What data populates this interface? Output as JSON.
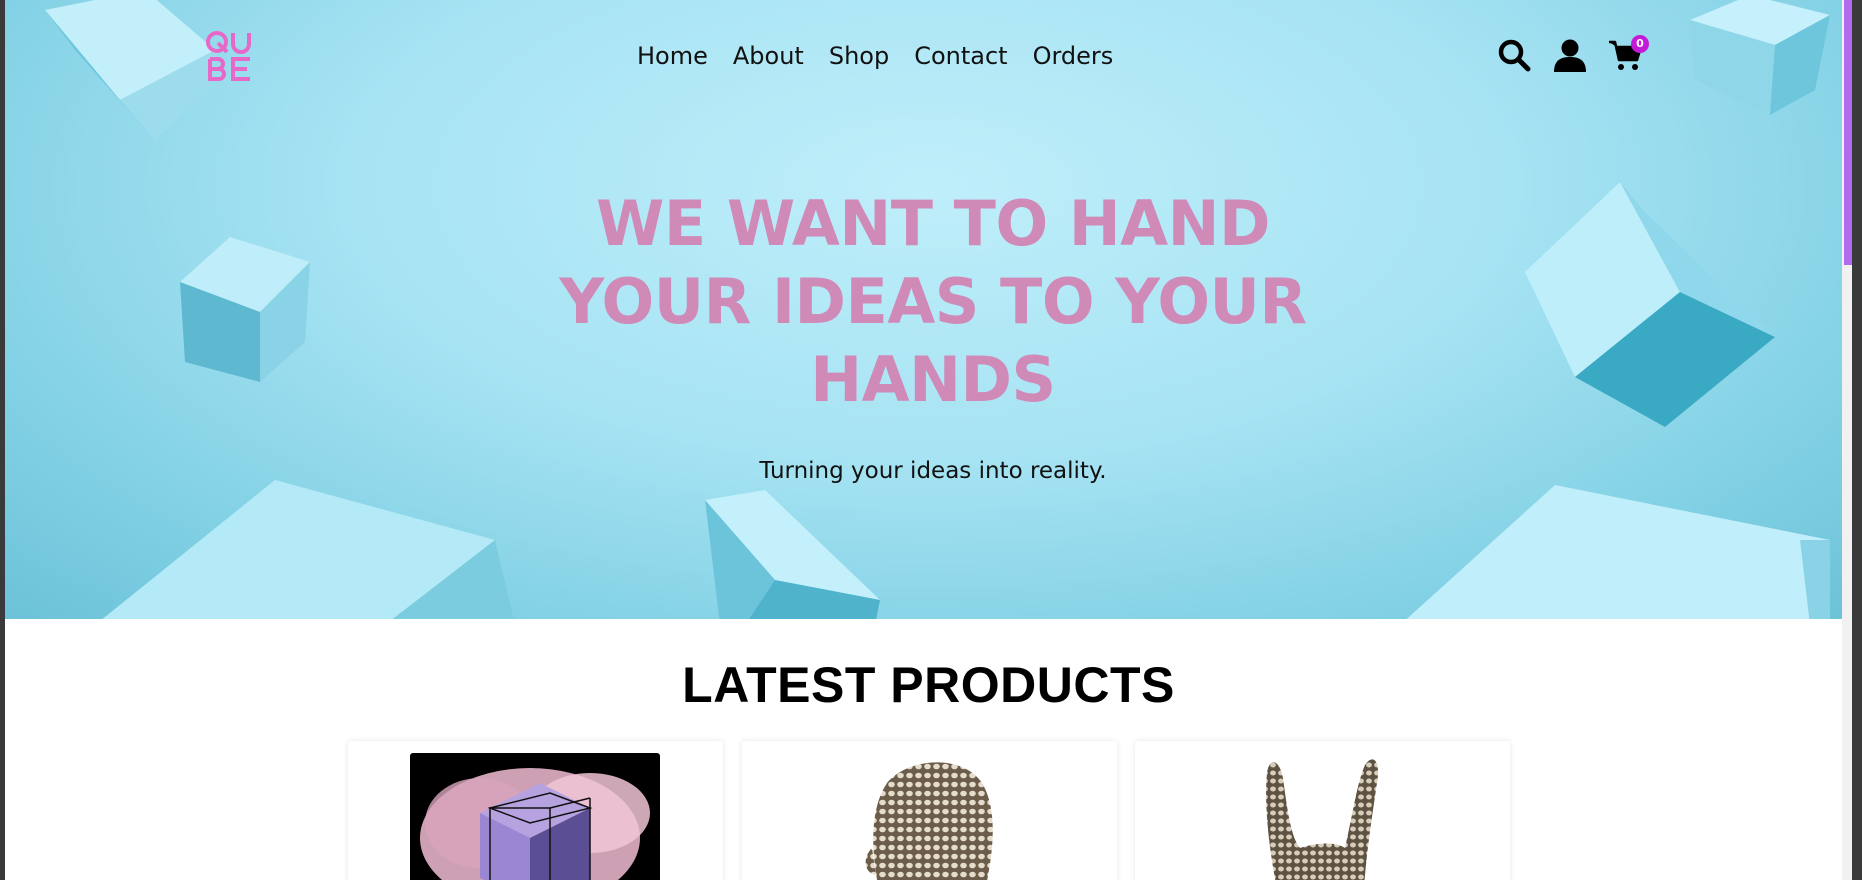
{
  "brand": {
    "logo_text_top": "QU",
    "logo_text_bottom": "BE",
    "accent": "#e868c8"
  },
  "nav": {
    "items": [
      {
        "label": "Home"
      },
      {
        "label": "About"
      },
      {
        "label": "Shop"
      },
      {
        "label": "Contact"
      },
      {
        "label": "Orders"
      }
    ]
  },
  "header_icons": {
    "search": "search-icon",
    "account": "user-icon",
    "cart": "cart-icon",
    "cart_count": "0",
    "badge_color": "#c21ad6"
  },
  "hero": {
    "headline": "WE WANT TO HAND YOUR IDEAS TO YOUR HANDS",
    "subtitle": "Turning your ideas into reality.",
    "headline_color": "#d08ab8"
  },
  "latest": {
    "title": "LATEST PRODUCTS",
    "products": [
      {
        "image": "abstract-cube-image"
      },
      {
        "image": "voronoi-head-image"
      },
      {
        "image": "voronoi-hand-image"
      }
    ]
  }
}
